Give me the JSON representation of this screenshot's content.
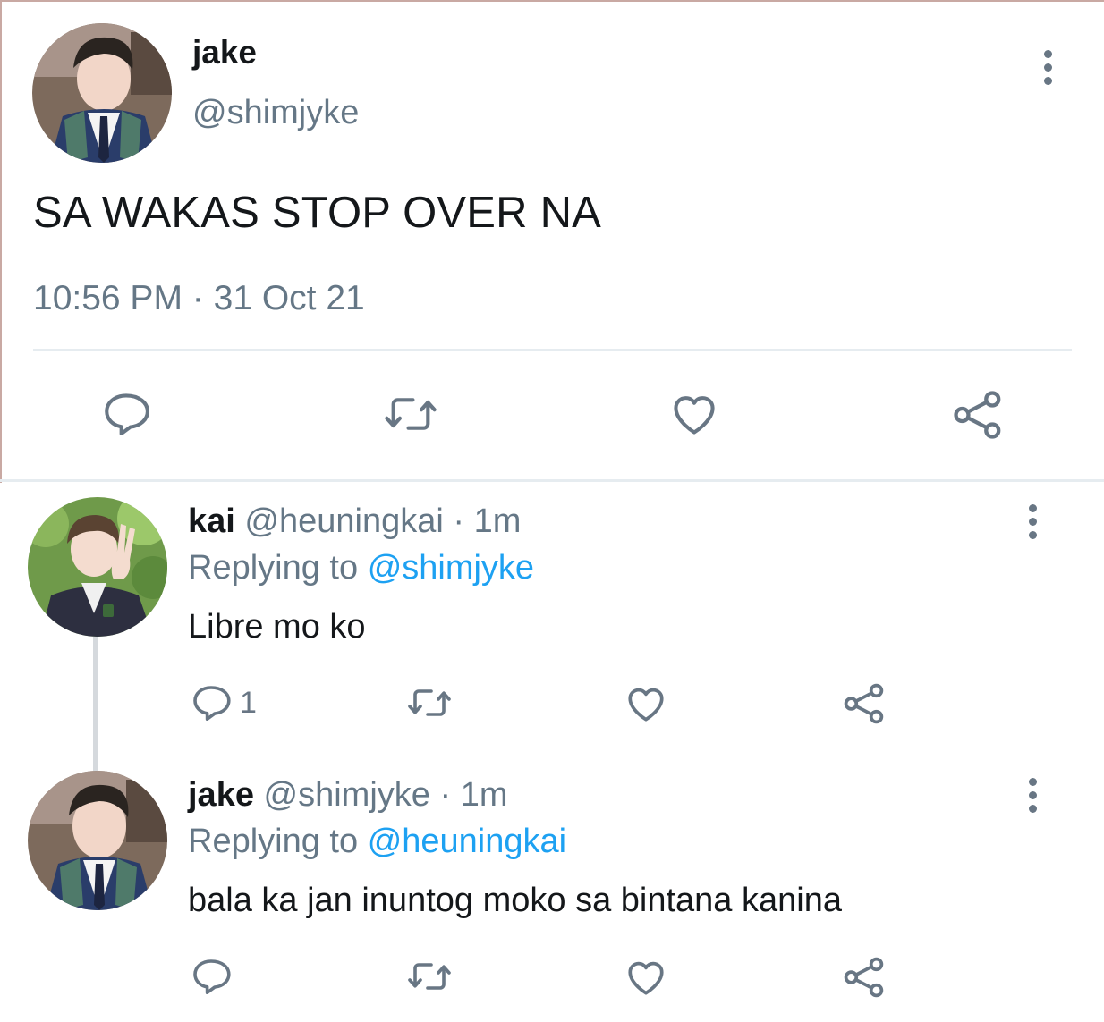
{
  "main_tweet": {
    "name": "jake",
    "handle": "@shimjyke",
    "text": "SA WAKAS STOP OVER NA",
    "time": "10:56 PM",
    "separator": "·",
    "date": "31 Oct 21",
    "avatar_icon": "avatar-photo-jake"
  },
  "replies": [
    {
      "name": "kai",
      "handle": "@heuningkai",
      "dot": "·",
      "age": "1m",
      "replying_label": "Replying to",
      "replying_to": "@shimjyke",
      "text": "Libre mo ko",
      "reply_count": "1",
      "avatar_icon": "avatar-photo-kai"
    },
    {
      "name": "jake",
      "handle": "@shimjyke",
      "dot": "·",
      "age": "1m",
      "replying_label": "Replying to",
      "replying_to": "@heuningkai",
      "text": "bala ka jan inuntog moko sa bintana kanina",
      "avatar_icon": "avatar-photo-jake"
    }
  ],
  "icons": [
    "reply-icon",
    "retweet-icon",
    "like-icon",
    "share-icon",
    "more-icon"
  ],
  "colors": {
    "text": "#14171a",
    "secondary": "#657786",
    "mention": "#1da1f2",
    "icon": "#687684",
    "divider": "#e6ecf0"
  }
}
